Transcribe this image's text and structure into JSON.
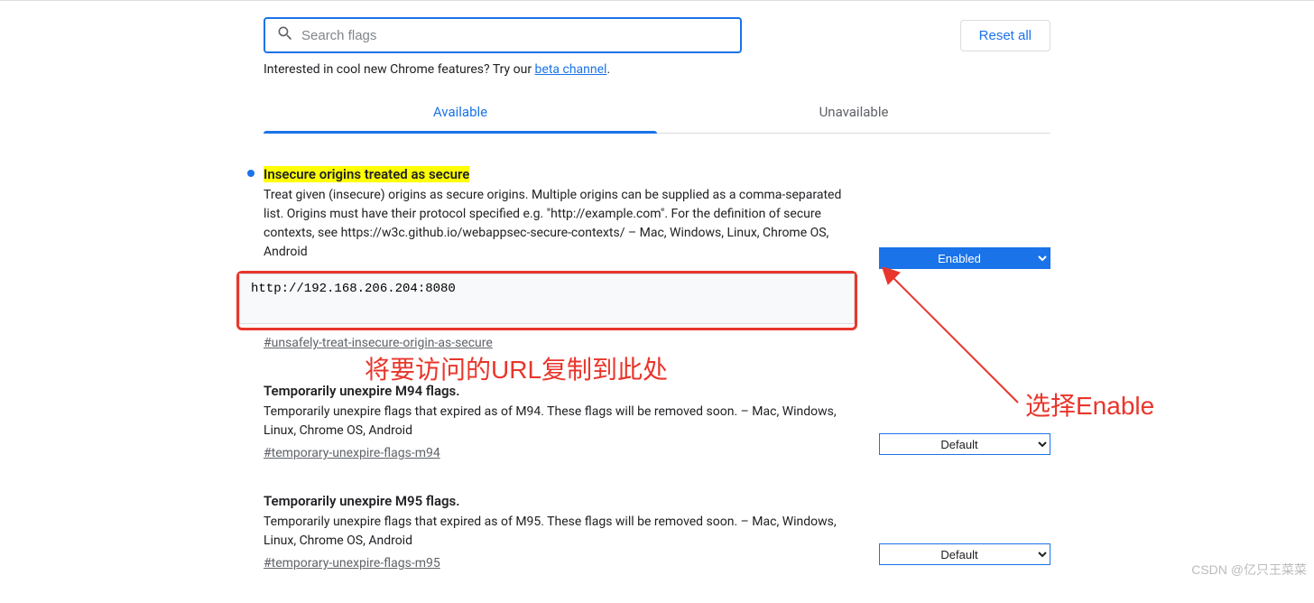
{
  "header": {
    "search_placeholder": "Search flags",
    "reset_label": "Reset all"
  },
  "promo": {
    "text_prefix": "Interested in cool new Chrome features? Try our ",
    "link_text": "beta channel",
    "text_suffix": "."
  },
  "tabs": {
    "available": "Available",
    "unavailable": "Unavailable"
  },
  "flags": [
    {
      "title": "Insecure origins treated as secure",
      "desc": "Treat given (insecure) origins as secure origins. Multiple origins can be supplied as a comma-separated list. Origins must have their protocol specified e.g. \"http://example.com\". For the definition of secure contexts, see https://w3c.github.io/webappsec-secure-contexts/ – Mac, Windows, Linux, Chrome OS, Android",
      "input_value": "http://192.168.206.204:8080",
      "anchor": "#unsafely-treat-insecure-origin-as-secure",
      "select_value": "Enabled",
      "highlighted": true,
      "bullet": true
    },
    {
      "title": "Temporarily unexpire M94 flags.",
      "desc": "Temporarily unexpire flags that expired as of M94. These flags will be removed soon. – Mac, Windows, Linux, Chrome OS, Android",
      "anchor": "#temporary-unexpire-flags-m94",
      "select_value": "Default"
    },
    {
      "title": "Temporarily unexpire M95 flags.",
      "desc": "Temporarily unexpire flags that expired as of M95. These flags will be removed soon. – Mac, Windows, Linux, Chrome OS, Android",
      "anchor": "#temporary-unexpire-flags-m95",
      "select_value": "Default"
    }
  ],
  "annotations": {
    "url_copy": "将要访问的URL复制到此处",
    "select_enable": "选择Enable"
  },
  "watermark": "CSDN @亿只王菜菜"
}
